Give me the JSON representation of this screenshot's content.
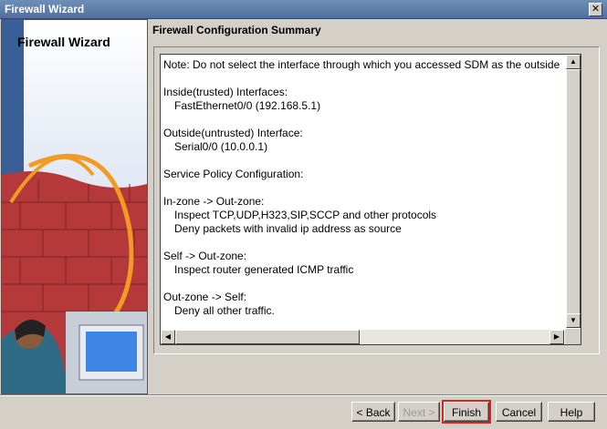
{
  "window": {
    "title": "Firewall Wizard",
    "close_glyph": "✕"
  },
  "left_panel": {
    "title": "Firewall Wizard"
  },
  "summary": {
    "heading": "Firewall Configuration Summary",
    "lines": [
      "Note: Do not select the interface through which you accessed SDM as the outside",
      "",
      "Inside(trusted) Interfaces:",
      "FastEthernet0/0 (192.168.5.1)",
      "",
      "Outside(untrusted) Interface:",
      "Serial0/0 (10.0.0.1)",
      "",
      "Service Policy Configuration:",
      "",
      "In-zone -> Out-zone:",
      "Inspect TCP,UDP,H323,SIP,SCCP and other protocols",
      "Deny packets with invalid ip address as source",
      "",
      "Self -> Out-zone:",
      "Inspect router generated ICMP traffic",
      "",
      "Out-zone -> Self:",
      "Deny all other traffic."
    ]
  },
  "scroll_glyphs": {
    "up": "▲",
    "down": "▼",
    "left": "◀",
    "right": "▶"
  },
  "buttons": {
    "back": "< Back",
    "next": "Next >",
    "finish": "Finish",
    "cancel": "Cancel",
    "help": "Help"
  }
}
